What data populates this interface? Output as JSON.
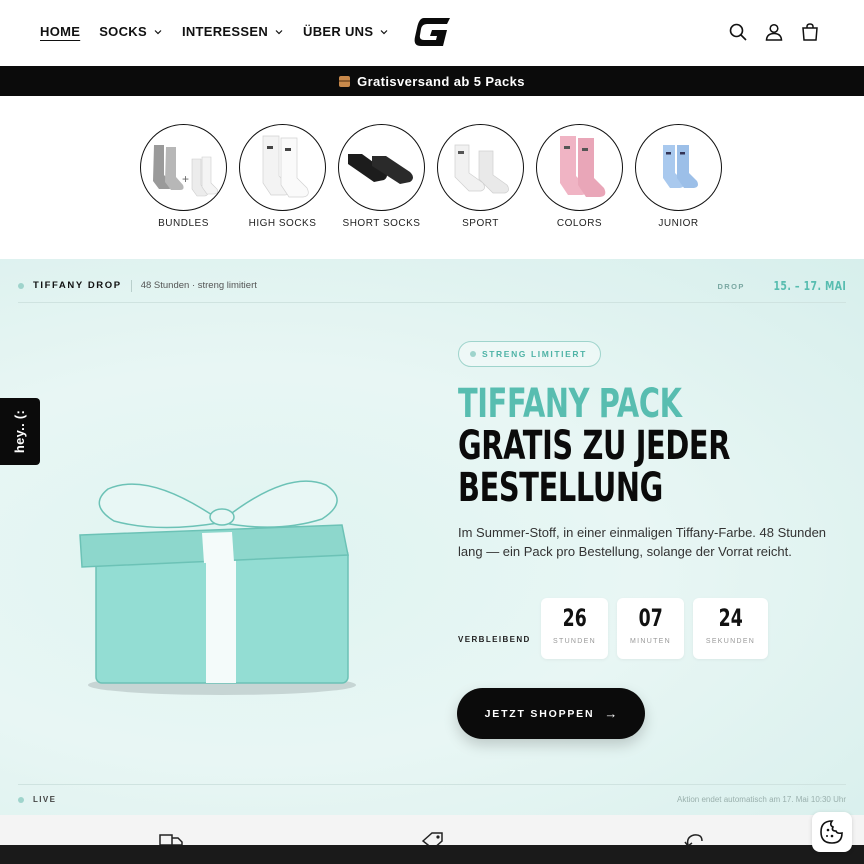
{
  "header": {
    "nav": [
      {
        "label": "HOME",
        "active": true
      },
      {
        "label": "SOCKS",
        "dropdown": true
      },
      {
        "label": "INTERESSEN",
        "dropdown": true
      },
      {
        "label": "ÜBER UNS",
        "dropdown": true
      }
    ],
    "icons": [
      "search-icon",
      "account-icon",
      "cart-icon"
    ]
  },
  "promo": {
    "text": "Gratisversand ab 5 Packs",
    "icon": "package-icon"
  },
  "categories": [
    {
      "label": "BUNDLES",
      "icon": "bundle-socks"
    },
    {
      "label": "HIGH SOCKS",
      "icon": "white-high-socks"
    },
    {
      "label": "SHORT SOCKS",
      "icon": "black-short-socks"
    },
    {
      "label": "SPORT",
      "icon": "white-sport-socks"
    },
    {
      "label": "COLORS",
      "icon": "pink-socks"
    },
    {
      "label": "JUNIOR",
      "icon": "blue-junior-socks"
    }
  ],
  "hero": {
    "drop_title": "TIFFANY DROP",
    "drop_sub": "48 Stunden · streng limitiert",
    "drop_label": "DROP",
    "drop_date": "15. – 17. MAI",
    "badge": "STRENG LIMITIERT",
    "headline": [
      "TIFFANY PACK",
      "GRATIS ZU JEDER",
      "BESTELLUNG"
    ],
    "description": "Im Summer-Stoff, in einer einmaligen Tiffany-Farbe. 48 Stunden lang — ein Pack pro Bestellung, solange der Vorrat reicht.",
    "countdown_label": "VERBLEIBEND",
    "countdown": [
      {
        "value": "26",
        "unit": "STUNDEN"
      },
      {
        "value": "07",
        "unit": "MINUTEN"
      },
      {
        "value": "24",
        "unit": "SEKUNDEN"
      }
    ],
    "cta": "JETZT SHOPPEN",
    "cta_arrow": "→",
    "live": "LIVE",
    "ends": "Aktion endet automatisch am 17. Mai 10:30 Uhr",
    "accent": "#58bdb0"
  },
  "side_tab": {
    "label": "hey.. (:"
  },
  "colors": {
    "black": "#0b0b0b",
    "tiffany": "#58bdb0",
    "gift": "#8fd9cf"
  }
}
